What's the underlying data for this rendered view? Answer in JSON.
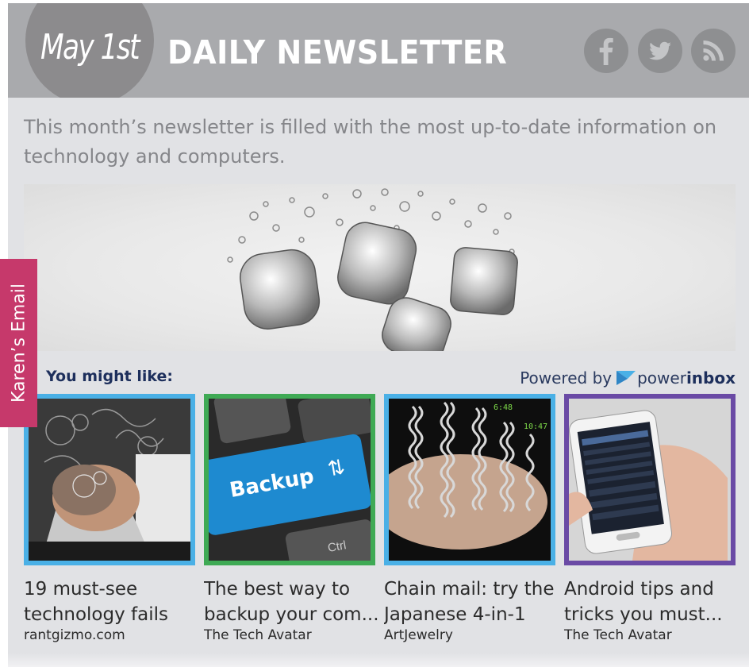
{
  "header": {
    "date": "May 1st",
    "title": "DAILY NEWSLETTER",
    "social": [
      "facebook-icon",
      "twitter-icon",
      "rss-icon"
    ]
  },
  "intro": "This month’s newsletter is filled with the most up-to-date information on technology and computers.",
  "side_tab": "Karen’s Email",
  "recommendations": {
    "heading": "You might like:",
    "powered_by": "Powered by",
    "brand_part1": "power",
    "brand_part2": "inbox",
    "items": [
      {
        "title_line1": "19 must-see",
        "title_line2": "technology fails",
        "source": "rantgizmo.com",
        "border": "#4ab0e6"
      },
      {
        "title_line1": "The best way to",
        "title_line2": "backup your com...",
        "source": "The Tech Avatar",
        "border": "#3faa55"
      },
      {
        "title_line1": "Chain mail: try the",
        "title_line2": "Japanese 4-in-1",
        "source": "ArtJewelry",
        "border": "#4ab0e6"
      },
      {
        "title_line1": "Android tips and",
        "title_line2": "tricks you must...",
        "source": "The Tech Avatar",
        "border": "#6a4aa5"
      }
    ],
    "thumb_texts": {
      "backup_key": "Backup",
      "ctrl_key": "Ctrl",
      "clock1": "6:48",
      "clock2": "10:47"
    }
  },
  "colors": {
    "header_bg": "#a9aaad",
    "side_tab": "#c6396b",
    "heading": "#1d2f5c"
  }
}
